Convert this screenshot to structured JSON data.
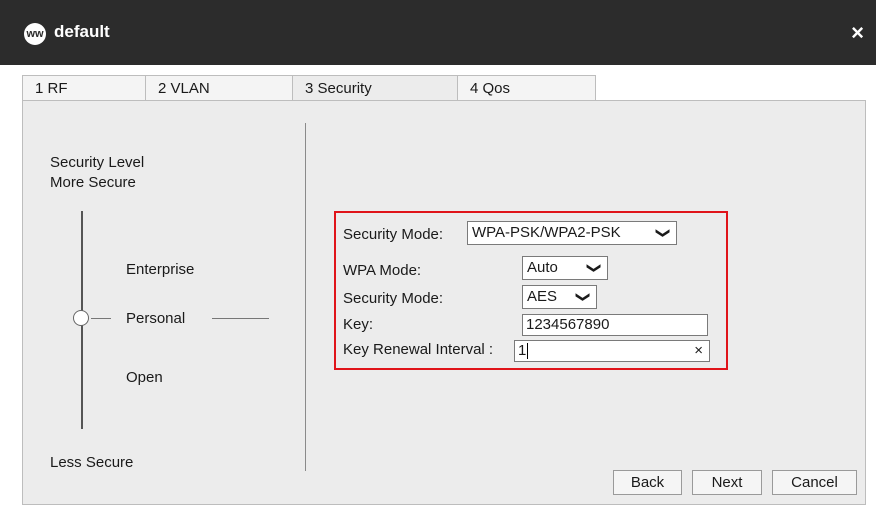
{
  "window": {
    "logo_text": "ᴡᴡ",
    "title": "default",
    "close_label": "×"
  },
  "tabs": [
    {
      "label": "1 RF"
    },
    {
      "label": "2 VLAN"
    },
    {
      "label": "3 Security"
    },
    {
      "label": "4 Qos"
    }
  ],
  "level": {
    "title": "Security Level",
    "more_secure": "More Secure",
    "less_secure": "Less Secure",
    "enterprise": "Enterprise",
    "personal": "Personal",
    "open": "Open"
  },
  "form": {
    "security_mode_label": "Security Mode:",
    "security_mode_value": "WPA-PSK/WPA2-PSK",
    "wpa_mode_label": "WPA Mode:",
    "wpa_mode_value": "Auto",
    "encryption_label": "Security Mode:",
    "encryption_value": "AES",
    "key_label": "Key:",
    "key_value": "1234567890",
    "renewal_label": "Key Renewal Interval :",
    "renewal_value": "1",
    "clear_label": "×",
    "chevron": "❯"
  },
  "buttons": {
    "back": "Back",
    "next": "Next",
    "cancel": "Cancel"
  },
  "colors": {
    "titlebar": "#2c2c2c",
    "highlight_box": "#e0141a"
  }
}
